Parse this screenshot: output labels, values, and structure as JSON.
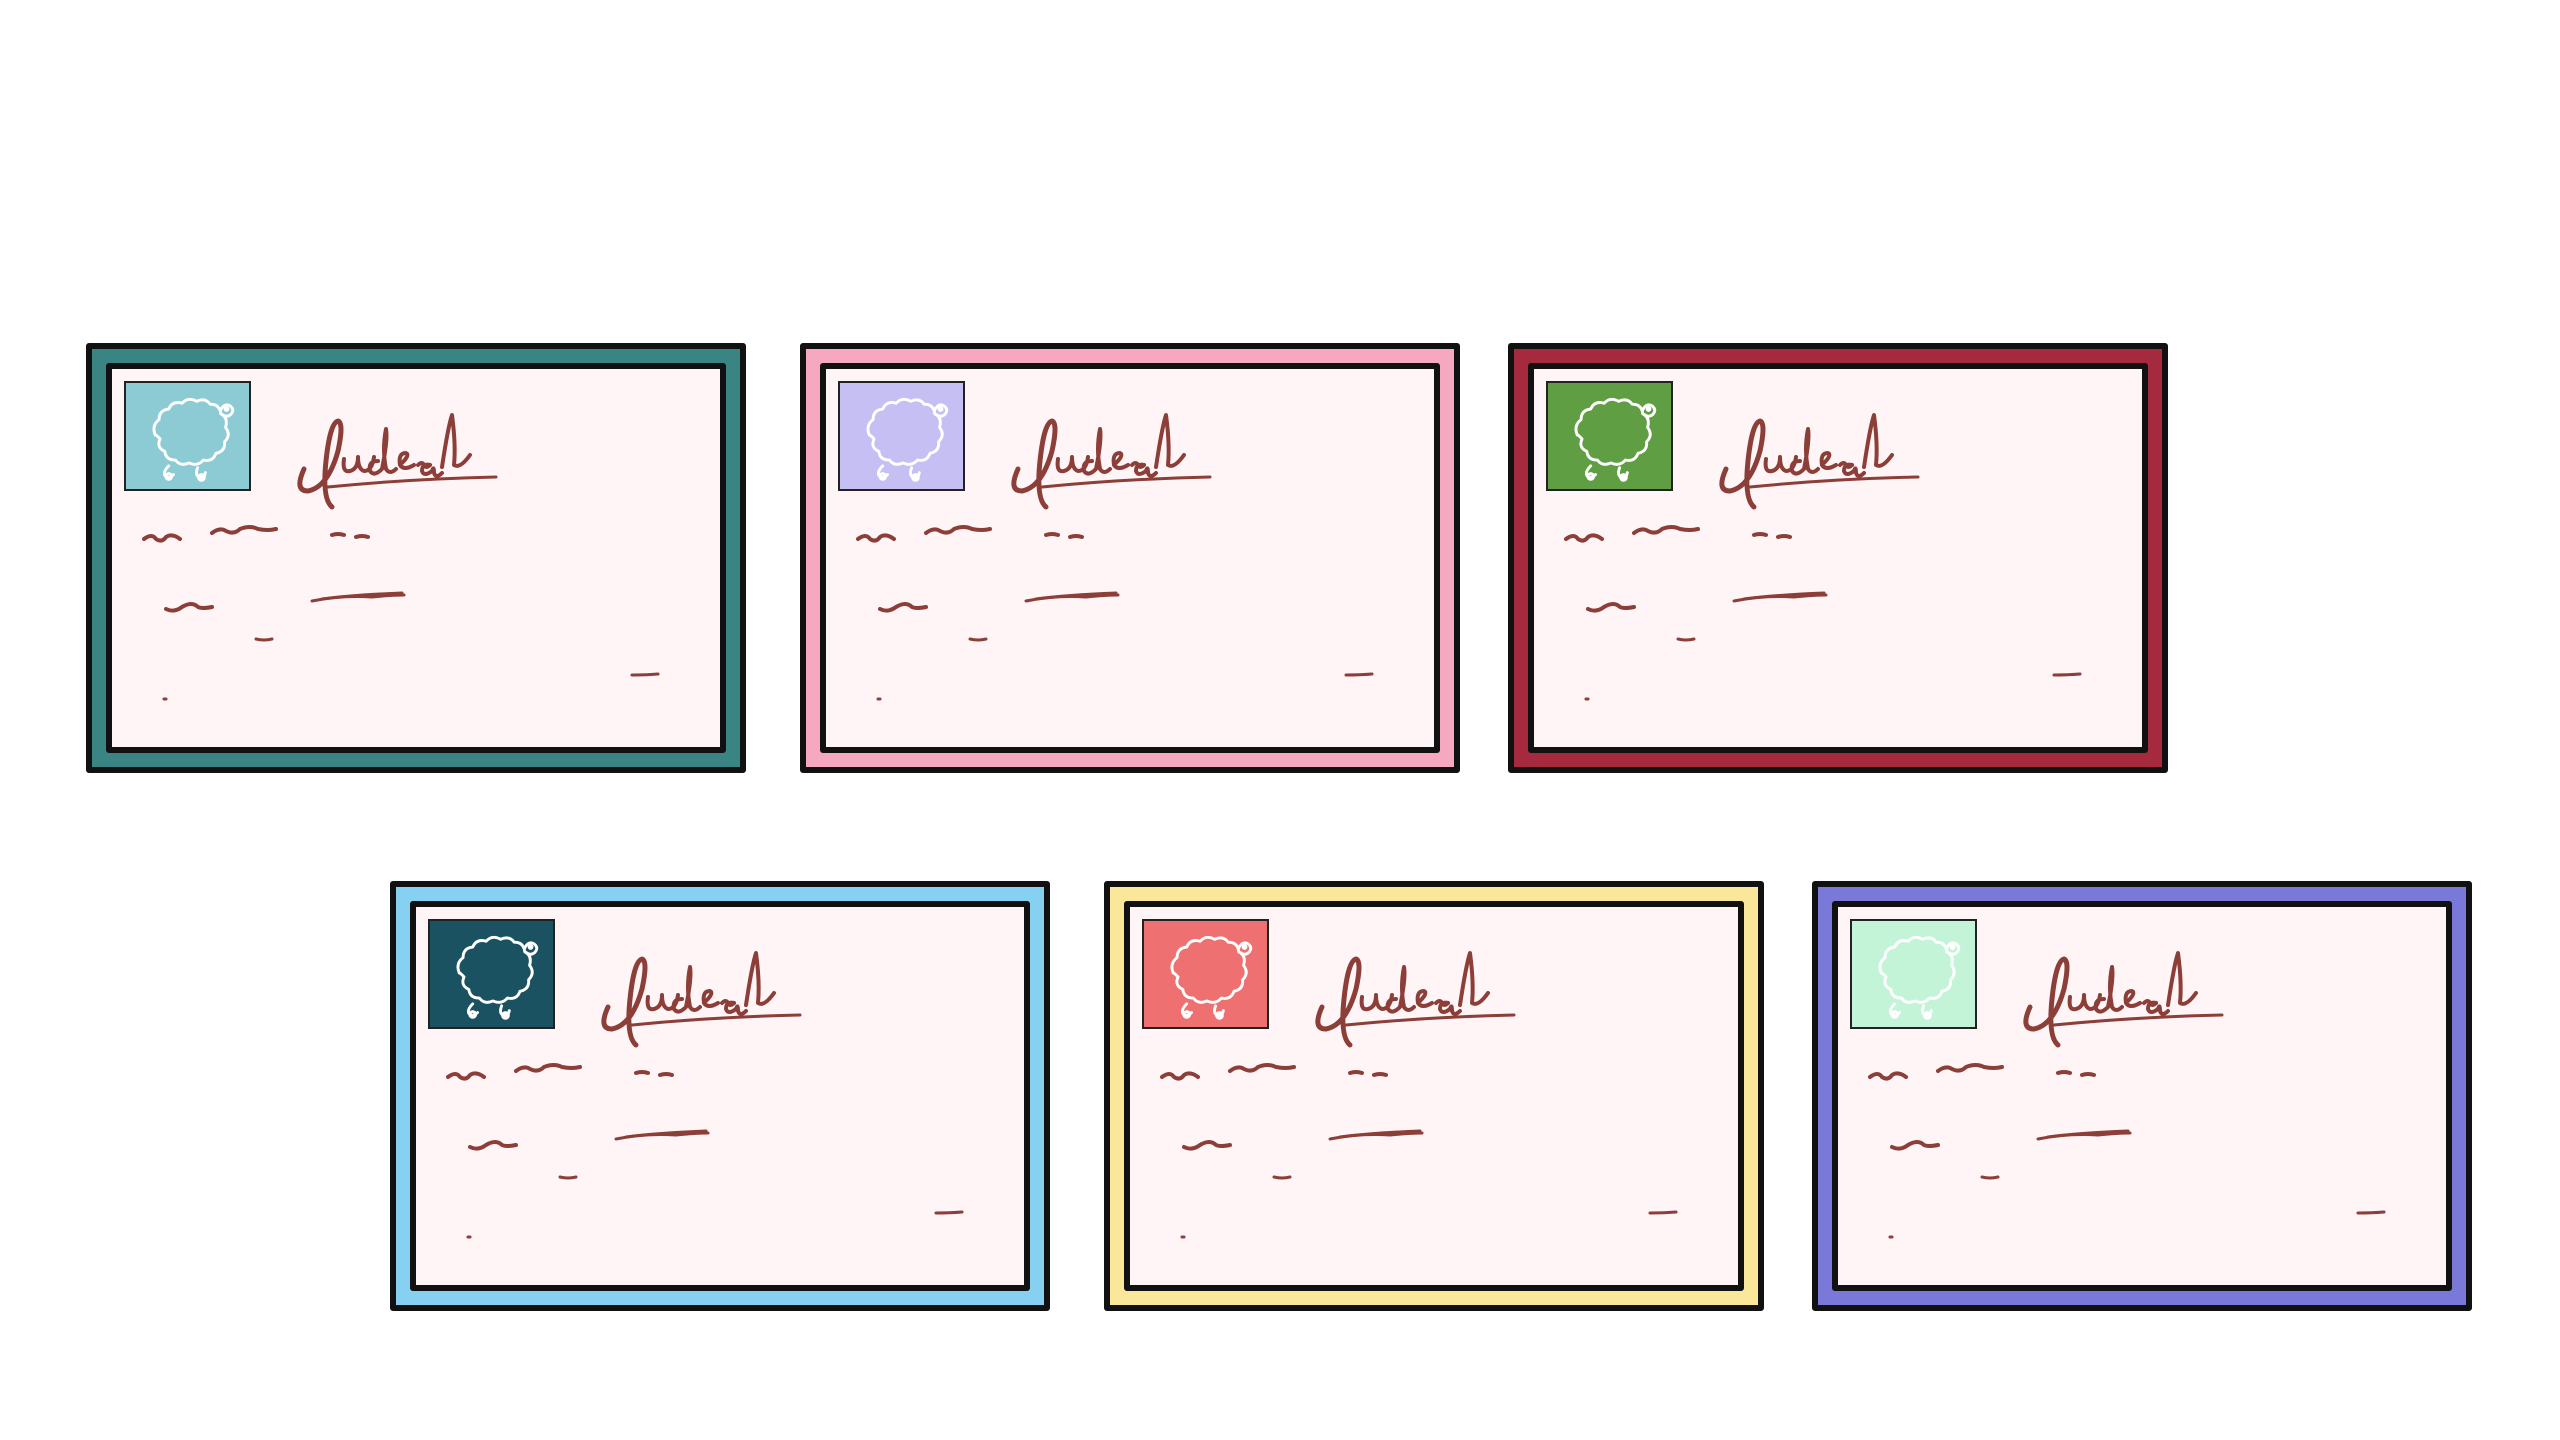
{
  "cards": [
    {
      "frame_color": "#3a8584",
      "photo_color": "#8ccbd4"
    },
    {
      "frame_color": "#f5a8c0",
      "photo_color": "#c5bff4"
    },
    {
      "frame_color": "#a52a3e",
      "photo_color": "#5f9e42"
    },
    {
      "frame_color": "#86d0f2",
      "photo_color": "#1b5262"
    },
    {
      "frame_color": "#fae79a",
      "photo_color": "#ef7070"
    },
    {
      "frame_color": "#7a78d8",
      "photo_color": "#c4f4d8"
    }
  ],
  "icons": {
    "photo": "sheep-icon",
    "text": "handwriting-scribble"
  },
  "colors": {
    "ink": "#8c3e38",
    "card_background": "#fff5f7",
    "outline": "#111111"
  }
}
